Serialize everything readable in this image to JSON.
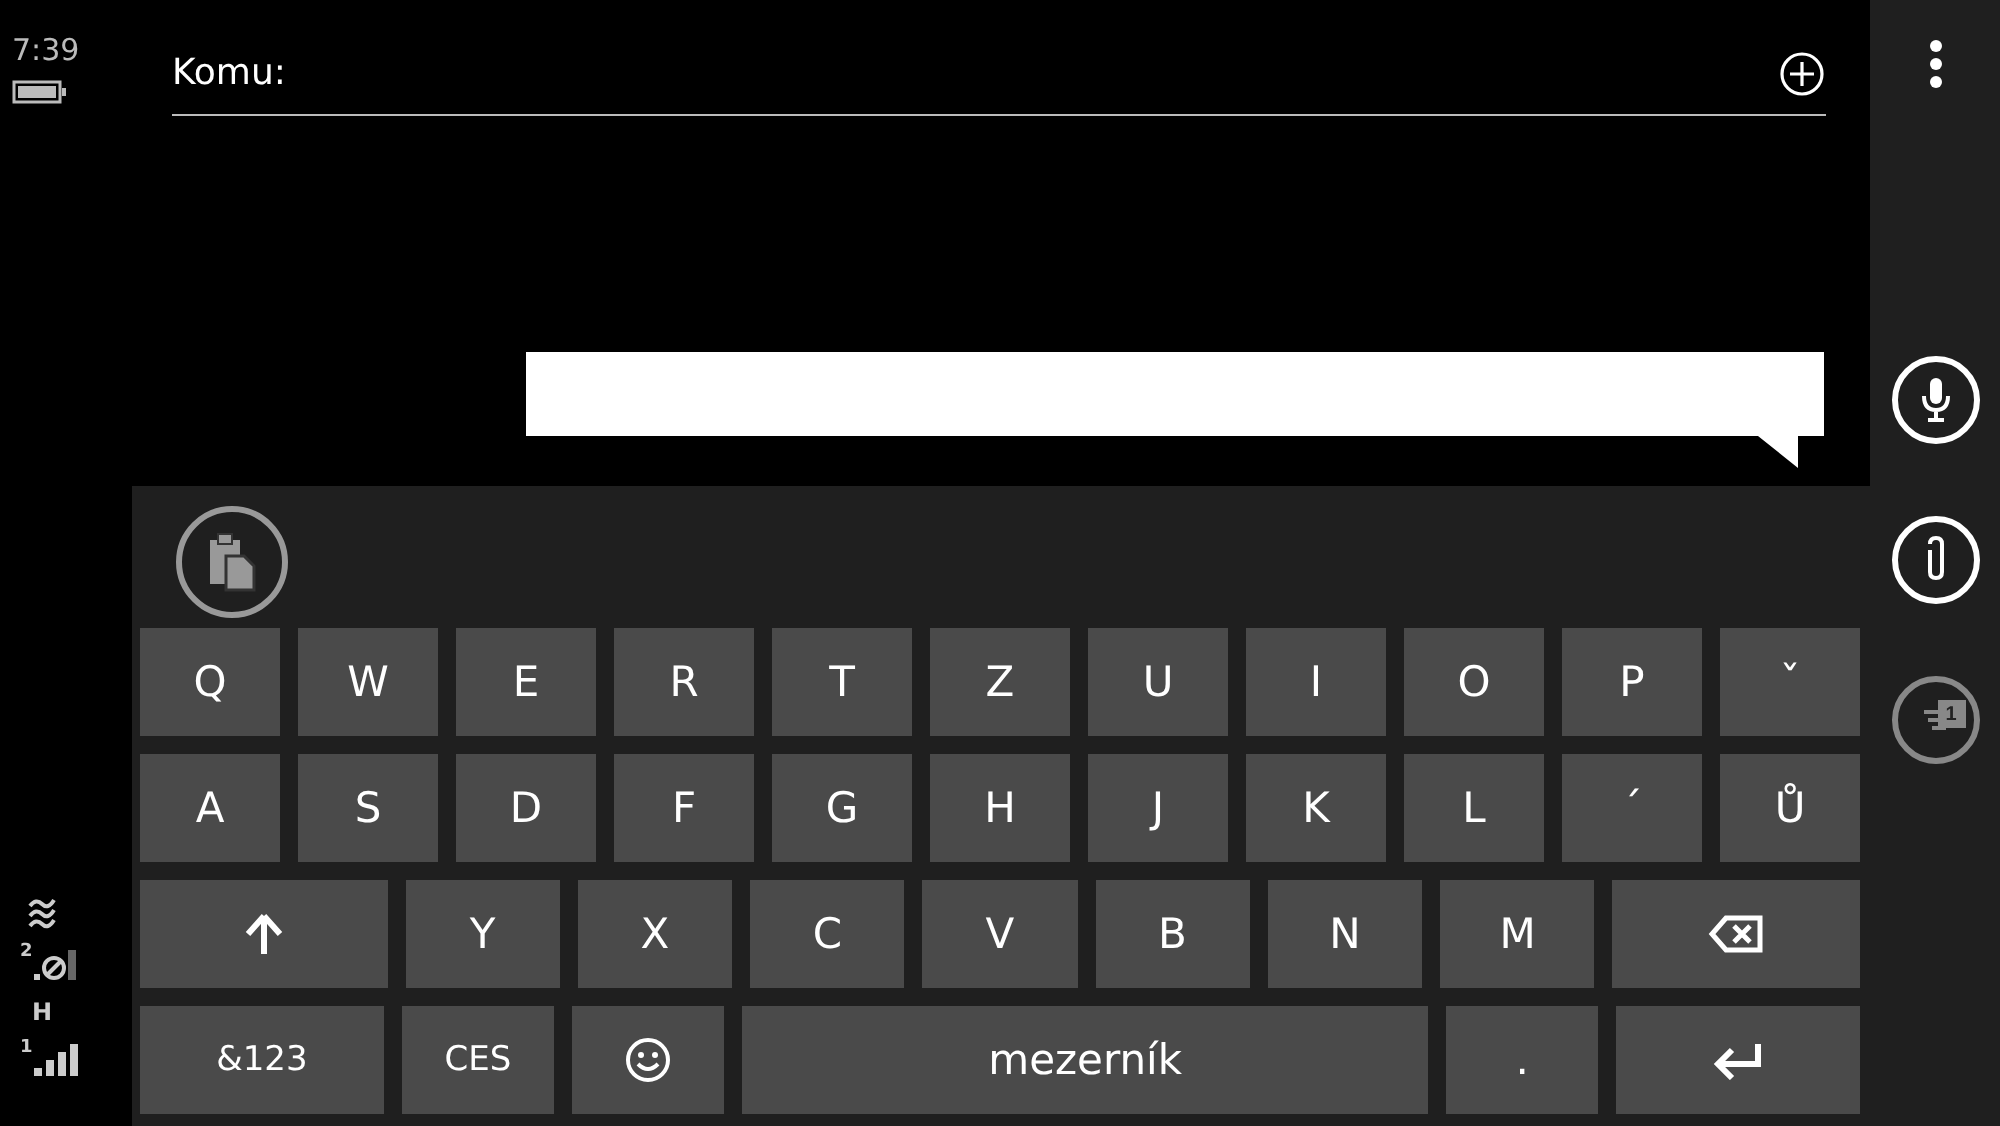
{
  "status_bar": {
    "time": "7:39",
    "sim2": {
      "slot": "2"
    },
    "network": "H",
    "sim1": {
      "slot": "1"
    }
  },
  "recipient": {
    "label": "Komu:"
  },
  "app_bar": {
    "buttons": [
      {
        "kind": "mic",
        "disabled": false
      },
      {
        "kind": "attach",
        "disabled": false
      },
      {
        "kind": "conversations",
        "count": "1",
        "disabled": true
      }
    ]
  },
  "keyboard": {
    "rows": [
      {
        "keys": [
          {
            "kind": "char",
            "label": "Q"
          },
          {
            "kind": "char",
            "label": "W"
          },
          {
            "kind": "char",
            "label": "E"
          },
          {
            "kind": "char",
            "label": "R"
          },
          {
            "kind": "char",
            "label": "T"
          },
          {
            "kind": "char",
            "label": "Z"
          },
          {
            "kind": "char",
            "label": "U"
          },
          {
            "kind": "char",
            "label": "I"
          },
          {
            "kind": "char",
            "label": "O"
          },
          {
            "kind": "char",
            "label": "P"
          },
          {
            "kind": "char",
            "label": "ˇ"
          }
        ]
      },
      {
        "keys": [
          {
            "kind": "char",
            "label": "A"
          },
          {
            "kind": "char",
            "label": "S"
          },
          {
            "kind": "char",
            "label": "D"
          },
          {
            "kind": "char",
            "label": "F"
          },
          {
            "kind": "char",
            "label": "G"
          },
          {
            "kind": "char",
            "label": "H"
          },
          {
            "kind": "char",
            "label": "J"
          },
          {
            "kind": "char",
            "label": "K"
          },
          {
            "kind": "char",
            "label": "L"
          },
          {
            "kind": "char",
            "label": "´"
          },
          {
            "kind": "char",
            "label": "Ů"
          }
        ]
      },
      {
        "keys": [
          {
            "kind": "shift"
          },
          {
            "kind": "char",
            "label": "Y"
          },
          {
            "kind": "char",
            "label": "X"
          },
          {
            "kind": "char",
            "label": "C"
          },
          {
            "kind": "char",
            "label": "V"
          },
          {
            "kind": "char",
            "label": "B"
          },
          {
            "kind": "char",
            "label": "N"
          },
          {
            "kind": "char",
            "label": "M"
          },
          {
            "kind": "backspace"
          }
        ]
      },
      {
        "keys": [
          {
            "kind": "mode",
            "label": "&123"
          },
          {
            "kind": "char",
            "label": "CES"
          },
          {
            "kind": "emoji"
          },
          {
            "kind": "space",
            "label": "mezerník"
          },
          {
            "kind": "char",
            "label": "."
          },
          {
            "kind": "enter"
          }
        ]
      }
    ]
  }
}
